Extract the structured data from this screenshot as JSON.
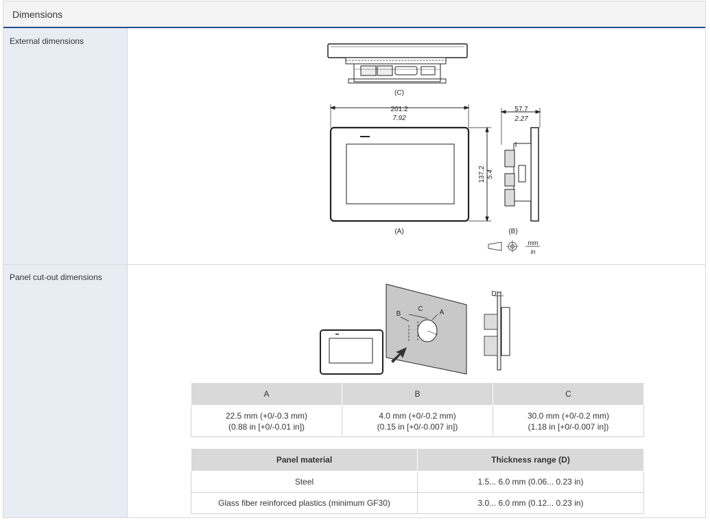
{
  "section": {
    "title": "Dimensions"
  },
  "rows": {
    "external": {
      "label": "External dimensions"
    },
    "cutout": {
      "label": "Panel cut-out dimensions"
    }
  },
  "drawing": {
    "view_c": "(C)",
    "view_a": "(A)",
    "view_b": "(B)",
    "width_mm": "201.2",
    "width_in": "7.92",
    "height_mm": "137.2",
    "height_in": "5.4",
    "depth_mm": "57.7",
    "depth_in": "2.27",
    "unit_mm": "mm",
    "unit_in": "in",
    "cut_a": "A",
    "cut_b": "B",
    "cut_c": "C",
    "cut_d": "D"
  },
  "cutout_table": {
    "headers": [
      "A",
      "B",
      "C"
    ],
    "values": [
      {
        "line1": "22.5 mm (+0/-0.3 mm)",
        "line2": "(0.88 in [+0/-0.01 in])"
      },
      {
        "line1": "4.0 mm (+0/-0.2 mm)",
        "line2": "(0.15 in [+0/-0.007 in])"
      },
      {
        "line1": "30.0 mm (+0/-0.2 mm)",
        "line2": "(1.18 in [+0/-0.007 in])"
      }
    ]
  },
  "material_table": {
    "headers": [
      "Panel material",
      "Thickness range (D)"
    ],
    "rows": [
      {
        "material": "Steel",
        "thickness": "1.5... 6.0 mm (0.06... 0.23 in)"
      },
      {
        "material": "Glass fiber reinforced plastics (minimum GF30)",
        "thickness": "3.0... 6.0 mm (0.12... 0.23 in)"
      }
    ]
  }
}
